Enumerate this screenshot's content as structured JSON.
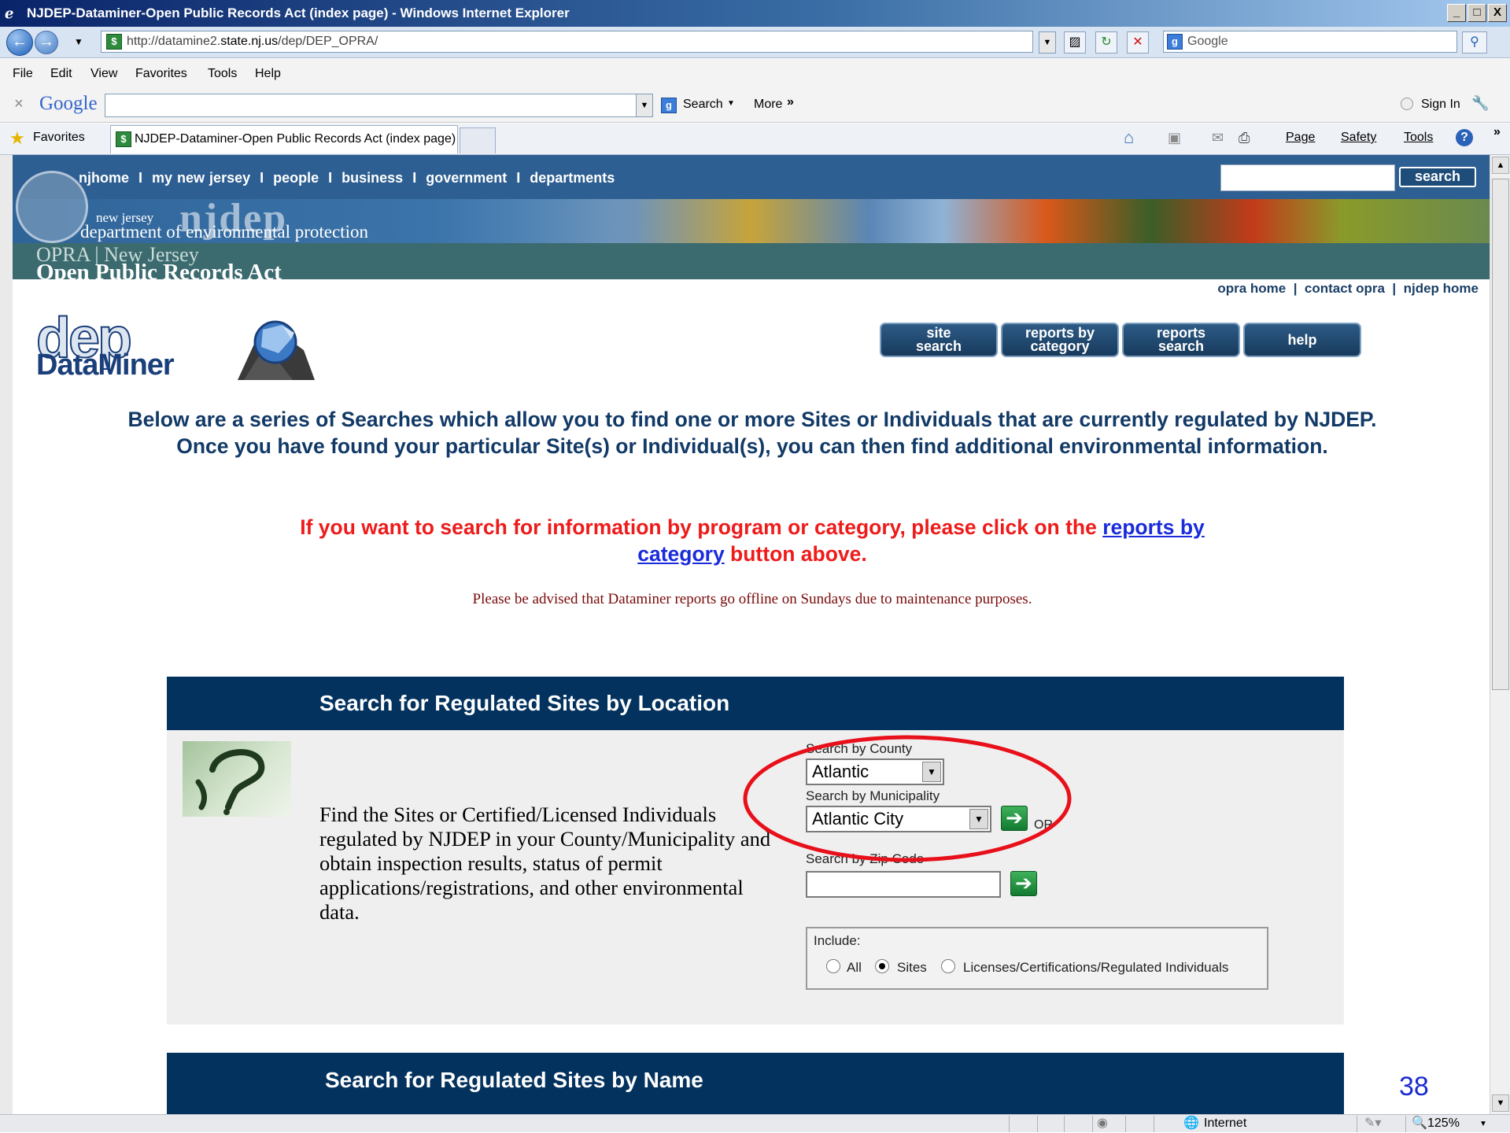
{
  "window": {
    "title": "NJDEP-Dataminer-Open Public Records Act (index page) - Windows Internet Explorer",
    "buttons": [
      "_",
      "□",
      "X"
    ]
  },
  "address": {
    "url_prefix": "http://datamine2.",
    "url_domain": "state.nj.us",
    "url_path": "/dep/DEP_OPRA/",
    "search_placeholder": "Google"
  },
  "menu": {
    "file": "File",
    "edit": "Edit",
    "view": "View",
    "favorites": "Favorites",
    "tools": "Tools",
    "help": "Help"
  },
  "googlebar": {
    "brand": "Google",
    "search_label": "Search",
    "more_label": "More",
    "sign_in": "Sign In"
  },
  "favbar": {
    "favorites": "Favorites",
    "tab_title": "NJDEP-Dataminer-Open Public Records Act (index page)",
    "page_menu": "Page",
    "safety_menu": "Safety",
    "tools_menu": "Tools"
  },
  "nj_header": {
    "links": [
      "njhome",
      "my new jersey",
      "people",
      "business",
      "government",
      "departments"
    ],
    "search_button": "search",
    "newjersey": "new jersey",
    "wordmark": "njdep",
    "department": "department of environmental protection",
    "opra_line1": "OPRA | New Jersey",
    "opra_line2": "Open Public Records Act",
    "opra_links": [
      "opra home",
      "contact opra",
      "njdep home"
    ]
  },
  "logo": {
    "dep": "dep",
    "dataminer": "DataMiner"
  },
  "nav_buttons": [
    {
      "line1": "site",
      "line2": "search"
    },
    {
      "line1": "reports by",
      "line2": "category"
    },
    {
      "line1": "reports",
      "line2": "search"
    },
    {
      "line1": "help",
      "line2": ""
    }
  ],
  "intro": {
    "text": "Below are a series of Searches which allow you to find one or more Sites or Individuals that are currently regulated by NJDEP. Once you have found your particular Site(s) or Individual(s), you can then find additional environmental information.",
    "red_before": "If you want to search for information by program or category, please click on the ",
    "red_link": "reports by category",
    "red_after": " button above.",
    "advisory": "Please be advised that Dataminer reports go offline on Sundays due to maintenance purposes."
  },
  "section_location": {
    "title": "Search for Regulated Sites by Location",
    "description": "Find the Sites or Certified/Licensed Individuals regulated by NJDEP in your County/Municipality and obtain inspection results, status of permit applications/registrations, and other environmental data.",
    "county_label": "Search by County",
    "county_value": "Atlantic",
    "municipality_label": "Search by Municipality",
    "municipality_value": "Atlantic City",
    "or_label": "OR",
    "zip_label": "Search by Zip Code",
    "include_label": "Include:",
    "include_options": [
      {
        "label": "All",
        "checked": false
      },
      {
        "label": "Sites",
        "checked": true
      },
      {
        "label": "Licenses/Certifications/Regulated Individuals",
        "checked": false
      }
    ]
  },
  "section_name": {
    "title": "Search for Regulated Sites by Name"
  },
  "slide_number": "38",
  "status": {
    "zone": "Internet",
    "zoom": "125%"
  },
  "colors": {
    "header_navy": "#03325e",
    "nj_blue": "#2e5f92",
    "opra_teal": "#3c6b6f",
    "alert_red": "#ee1b1b",
    "annotation_red": "#e8101a"
  }
}
